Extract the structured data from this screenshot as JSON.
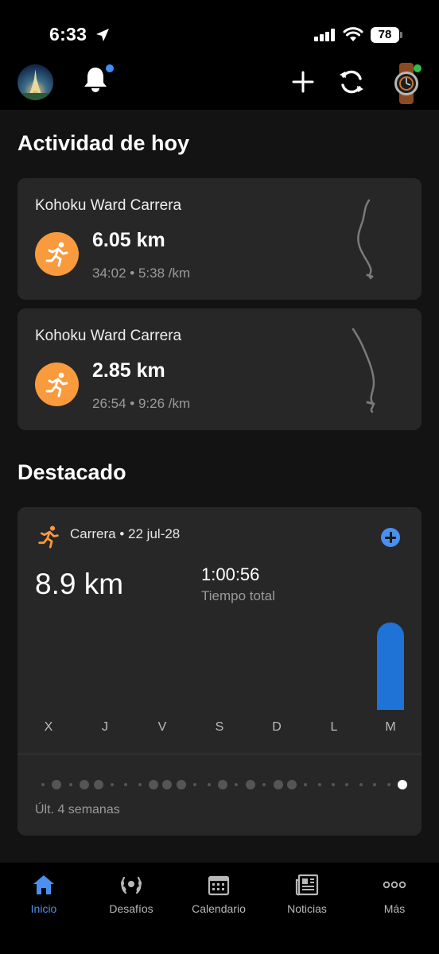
{
  "status_bar": {
    "time": "6:33",
    "battery": "78"
  },
  "today": {
    "title": "Actividad de hoy",
    "activities": [
      {
        "title": "Kohoku Ward Carrera",
        "distance": "6.05 km",
        "duration": "34:02",
        "pace": "5:38 /km"
      },
      {
        "title": "Kohoku Ward Carrera",
        "distance": "2.85 km",
        "duration": "26:54",
        "pace": "9:26 /km"
      }
    ]
  },
  "highlight": {
    "title": "Destacado",
    "activity_type": "Carrera",
    "date": "22 jul-28",
    "distance": "8.9 km",
    "total_time": "1:00:56",
    "total_time_label": "Tiempo total",
    "days": [
      "X",
      "J",
      "V",
      "S",
      "D",
      "L",
      "M"
    ],
    "weeks_label": "Últ. 4 semanas"
  },
  "chart_data": {
    "type": "bar",
    "categories": [
      "X",
      "J",
      "V",
      "S",
      "D",
      "L",
      "M"
    ],
    "values": [
      0,
      0,
      0,
      0,
      0,
      0,
      8.9
    ],
    "title": "",
    "xlabel": "",
    "ylabel": ""
  },
  "tabs": [
    {
      "label": "Inicio",
      "icon": "home-icon",
      "active": true
    },
    {
      "label": "Desafíos",
      "icon": "laurel-icon",
      "active": false
    },
    {
      "label": "Calendario",
      "icon": "calendar-icon",
      "active": false
    },
    {
      "label": "Noticias",
      "icon": "newspaper-icon",
      "active": false
    },
    {
      "label": "Más",
      "icon": "more-icon",
      "active": false
    }
  ],
  "colors": {
    "accent": "#4a90f0",
    "activity_orange": "#f99a3c",
    "bar_blue": "#1f72d6"
  }
}
